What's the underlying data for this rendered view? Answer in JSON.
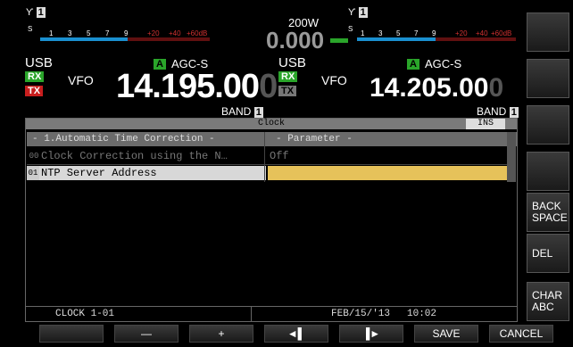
{
  "power": "200W",
  "center_freq": "0.000",
  "left": {
    "antenna": "1",
    "mode": "USB",
    "vfo": "VFO",
    "agc_tag": "A",
    "agc": "AGC-S",
    "rx": "RX",
    "tx": "TX",
    "freq_main": "14.195.00",
    "freq_last": "0",
    "band": "BAND",
    "band_num": "1",
    "scale": [
      "S",
      "1",
      "3",
      "5",
      "7",
      "9",
      "+20",
      "+40",
      "+60dB"
    ]
  },
  "right": {
    "antenna": "1",
    "mode": "USB",
    "vfo": "VFO",
    "agc_tag": "A",
    "agc": "AGC-S",
    "rx": "RX",
    "tx": "TX",
    "freq_main": "14.205.00",
    "freq_last": "0",
    "band": "BAND",
    "band_num": "1",
    "scale": [
      "S",
      "1",
      "3",
      "5",
      "7",
      "9",
      "+20",
      "+40",
      "+60dB"
    ]
  },
  "menu": {
    "title": "Clock",
    "ins": "INS",
    "col1_header": "- 1.Automatic Time Correction -",
    "col2_header": "- Parameter -",
    "rows": [
      {
        "num": "00",
        "label": "Clock Correction using the N…",
        "value": "Off"
      },
      {
        "num": "01",
        "label": "NTP Server Address",
        "value": ""
      }
    ]
  },
  "status": {
    "menu_id": "CLOCK 1-01",
    "date": "FEB/15/'13",
    "time": "10:02"
  },
  "side_buttons": [
    "",
    "",
    "",
    "",
    "BACK SPACE",
    "DEL",
    "CHAR ABC"
  ],
  "bottom_buttons": [
    "",
    "—",
    "+",
    "◄▌",
    "▐►",
    "SAVE",
    "CANCEL"
  ],
  "colors": {
    "rx_green": "#2aa52a",
    "tx_red": "#c81e1e",
    "highlight_row": "#d8d8d8",
    "value_yellow": "#e6c25a",
    "menu_title_bar": "#7a7a7a",
    "header_row": "#6b6b6b"
  }
}
